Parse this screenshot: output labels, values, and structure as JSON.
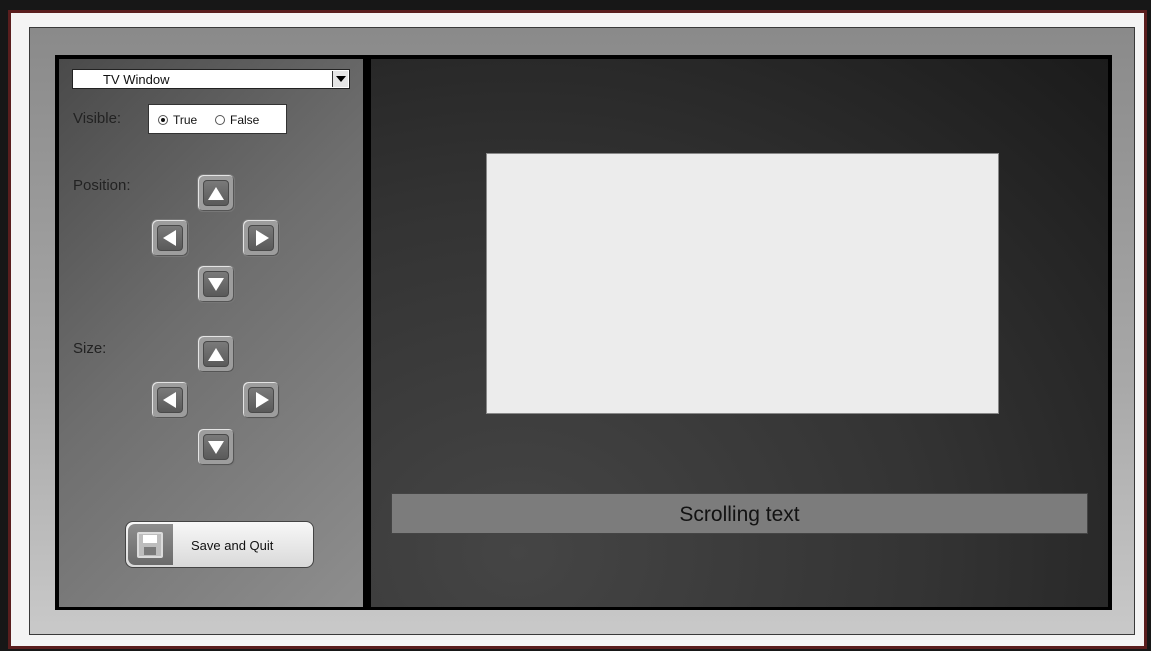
{
  "window_select": {
    "value": "TV Window"
  },
  "visible": {
    "label": "Visible:",
    "options": [
      {
        "label": "True",
        "selected": true
      },
      {
        "label": "False",
        "selected": false
      }
    ]
  },
  "position": {
    "label": "Position:"
  },
  "size": {
    "label": "Size:"
  },
  "save_button": {
    "label": "Save and Quit",
    "icon": "floppy-disk-icon"
  },
  "preview": {
    "scrolling_text": "Scrolling text"
  }
}
